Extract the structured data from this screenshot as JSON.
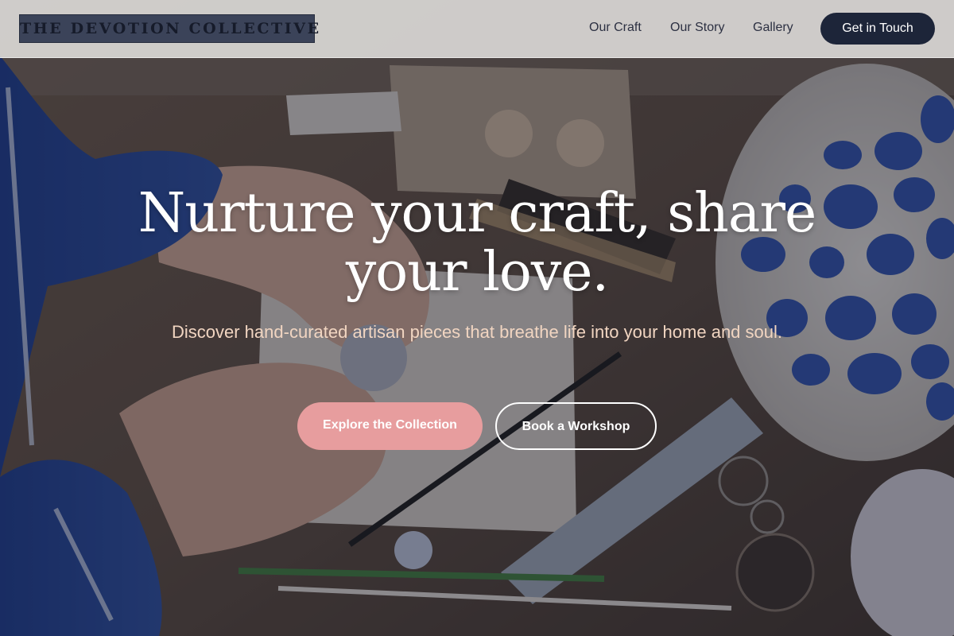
{
  "brand": {
    "logo_text": "THE DEVOTION COLLECTIVE"
  },
  "nav": {
    "links": [
      "Our Craft",
      "Our Story",
      "Gallery"
    ],
    "cta_label": "Get in Touch"
  },
  "hero": {
    "title": "Nurture your craft, share your love.",
    "subtitle": "Discover hand-curated artisan pieces that breathe life into your home and soul.",
    "primary_button": "Explore the Collection",
    "secondary_button": "Book a Workshop",
    "background_image": "artisan-workbench-clay-crafting-photo"
  },
  "colors": {
    "nav_background": "#f4f2f0",
    "logo_block": "#3b4359",
    "cta_dark": "#1d2539",
    "primary_pink": "#e79d9e",
    "subtitle_peach": "#f1d5c1"
  }
}
